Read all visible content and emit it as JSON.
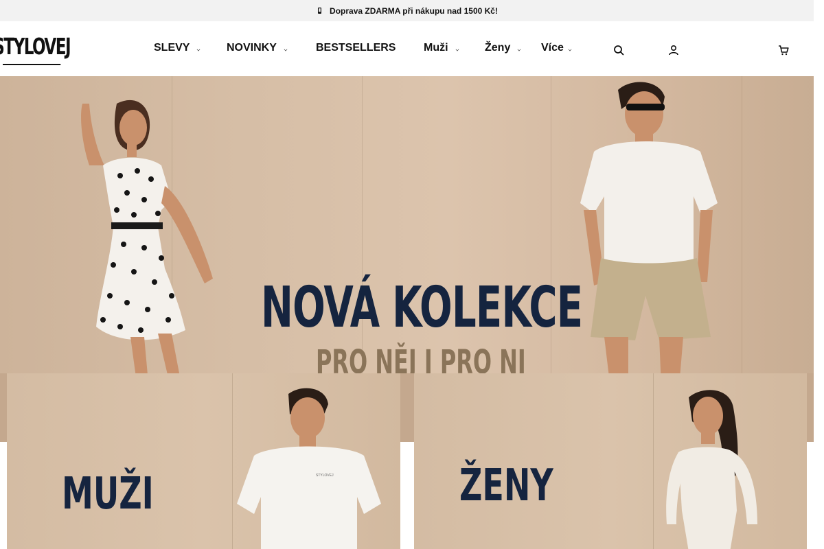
{
  "announcement": {
    "icon": "truck-icon",
    "text": "Doprava ZDARMA při nákupu nad 1500 Kč!"
  },
  "header": {
    "logo_text": "STYLOVEJ",
    "nav": [
      {
        "label": "SLEVY",
        "has_dropdown": true
      },
      {
        "label": "NOVINKY",
        "has_dropdown": true
      },
      {
        "label": "BESTSELLERS",
        "has_dropdown": false
      },
      {
        "label": "Muži",
        "has_dropdown": true
      },
      {
        "label": "Ženy",
        "has_dropdown": true
      },
      {
        "label": "Více",
        "has_dropdown": true
      }
    ],
    "icons": [
      "search-icon",
      "user-icon",
      "cart-icon"
    ]
  },
  "hero": {
    "title": "NOVÁ KOLEKCE",
    "subtitle": "PRO NĚJ I PRO NI"
  },
  "categories": [
    {
      "title": "MUŽI"
    },
    {
      "title": "ŽENY"
    }
  ],
  "colors": {
    "brand_navy": "#15243f",
    "subtitle_tan": "#8a7459",
    "topbar_bg": "#f2f2f2"
  }
}
